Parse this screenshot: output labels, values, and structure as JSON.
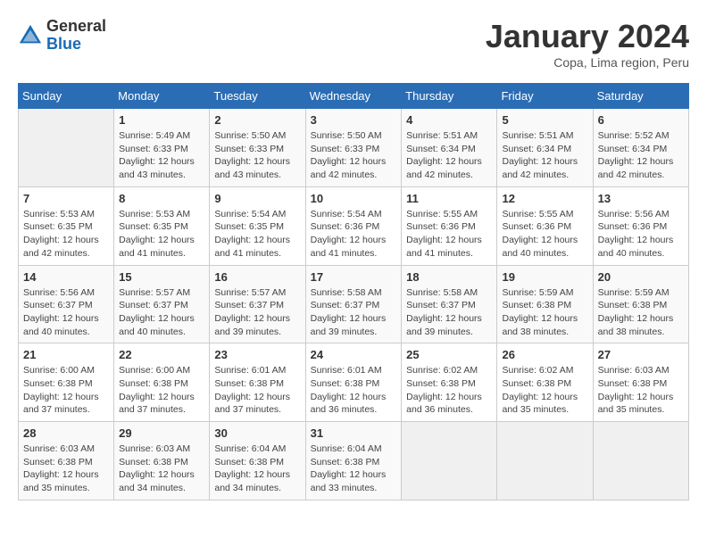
{
  "logo": {
    "general": "General",
    "blue": "Blue"
  },
  "title": "January 2024",
  "subtitle": "Copa, Lima region, Peru",
  "days_header": [
    "Sunday",
    "Monday",
    "Tuesday",
    "Wednesday",
    "Thursday",
    "Friday",
    "Saturday"
  ],
  "weeks": [
    [
      {
        "num": "",
        "info": ""
      },
      {
        "num": "1",
        "info": "Sunrise: 5:49 AM\nSunset: 6:33 PM\nDaylight: 12 hours\nand 43 minutes."
      },
      {
        "num": "2",
        "info": "Sunrise: 5:50 AM\nSunset: 6:33 PM\nDaylight: 12 hours\nand 43 minutes."
      },
      {
        "num": "3",
        "info": "Sunrise: 5:50 AM\nSunset: 6:33 PM\nDaylight: 12 hours\nand 42 minutes."
      },
      {
        "num": "4",
        "info": "Sunrise: 5:51 AM\nSunset: 6:34 PM\nDaylight: 12 hours\nand 42 minutes."
      },
      {
        "num": "5",
        "info": "Sunrise: 5:51 AM\nSunset: 6:34 PM\nDaylight: 12 hours\nand 42 minutes."
      },
      {
        "num": "6",
        "info": "Sunrise: 5:52 AM\nSunset: 6:34 PM\nDaylight: 12 hours\nand 42 minutes."
      }
    ],
    [
      {
        "num": "7",
        "info": "Sunrise: 5:53 AM\nSunset: 6:35 PM\nDaylight: 12 hours\nand 42 minutes."
      },
      {
        "num": "8",
        "info": "Sunrise: 5:53 AM\nSunset: 6:35 PM\nDaylight: 12 hours\nand 41 minutes."
      },
      {
        "num": "9",
        "info": "Sunrise: 5:54 AM\nSunset: 6:35 PM\nDaylight: 12 hours\nand 41 minutes."
      },
      {
        "num": "10",
        "info": "Sunrise: 5:54 AM\nSunset: 6:36 PM\nDaylight: 12 hours\nand 41 minutes."
      },
      {
        "num": "11",
        "info": "Sunrise: 5:55 AM\nSunset: 6:36 PM\nDaylight: 12 hours\nand 41 minutes."
      },
      {
        "num": "12",
        "info": "Sunrise: 5:55 AM\nSunset: 6:36 PM\nDaylight: 12 hours\nand 40 minutes."
      },
      {
        "num": "13",
        "info": "Sunrise: 5:56 AM\nSunset: 6:36 PM\nDaylight: 12 hours\nand 40 minutes."
      }
    ],
    [
      {
        "num": "14",
        "info": "Sunrise: 5:56 AM\nSunset: 6:37 PM\nDaylight: 12 hours\nand 40 minutes."
      },
      {
        "num": "15",
        "info": "Sunrise: 5:57 AM\nSunset: 6:37 PM\nDaylight: 12 hours\nand 40 minutes."
      },
      {
        "num": "16",
        "info": "Sunrise: 5:57 AM\nSunset: 6:37 PM\nDaylight: 12 hours\nand 39 minutes."
      },
      {
        "num": "17",
        "info": "Sunrise: 5:58 AM\nSunset: 6:37 PM\nDaylight: 12 hours\nand 39 minutes."
      },
      {
        "num": "18",
        "info": "Sunrise: 5:58 AM\nSunset: 6:37 PM\nDaylight: 12 hours\nand 39 minutes."
      },
      {
        "num": "19",
        "info": "Sunrise: 5:59 AM\nSunset: 6:38 PM\nDaylight: 12 hours\nand 38 minutes."
      },
      {
        "num": "20",
        "info": "Sunrise: 5:59 AM\nSunset: 6:38 PM\nDaylight: 12 hours\nand 38 minutes."
      }
    ],
    [
      {
        "num": "21",
        "info": "Sunrise: 6:00 AM\nSunset: 6:38 PM\nDaylight: 12 hours\nand 37 minutes."
      },
      {
        "num": "22",
        "info": "Sunrise: 6:00 AM\nSunset: 6:38 PM\nDaylight: 12 hours\nand 37 minutes."
      },
      {
        "num": "23",
        "info": "Sunrise: 6:01 AM\nSunset: 6:38 PM\nDaylight: 12 hours\nand 37 minutes."
      },
      {
        "num": "24",
        "info": "Sunrise: 6:01 AM\nSunset: 6:38 PM\nDaylight: 12 hours\nand 36 minutes."
      },
      {
        "num": "25",
        "info": "Sunrise: 6:02 AM\nSunset: 6:38 PM\nDaylight: 12 hours\nand 36 minutes."
      },
      {
        "num": "26",
        "info": "Sunrise: 6:02 AM\nSunset: 6:38 PM\nDaylight: 12 hours\nand 35 minutes."
      },
      {
        "num": "27",
        "info": "Sunrise: 6:03 AM\nSunset: 6:38 PM\nDaylight: 12 hours\nand 35 minutes."
      }
    ],
    [
      {
        "num": "28",
        "info": "Sunrise: 6:03 AM\nSunset: 6:38 PM\nDaylight: 12 hours\nand 35 minutes."
      },
      {
        "num": "29",
        "info": "Sunrise: 6:03 AM\nSunset: 6:38 PM\nDaylight: 12 hours\nand 34 minutes."
      },
      {
        "num": "30",
        "info": "Sunrise: 6:04 AM\nSunset: 6:38 PM\nDaylight: 12 hours\nand 34 minutes."
      },
      {
        "num": "31",
        "info": "Sunrise: 6:04 AM\nSunset: 6:38 PM\nDaylight: 12 hours\nand 33 minutes."
      },
      {
        "num": "",
        "info": ""
      },
      {
        "num": "",
        "info": ""
      },
      {
        "num": "",
        "info": ""
      }
    ]
  ]
}
